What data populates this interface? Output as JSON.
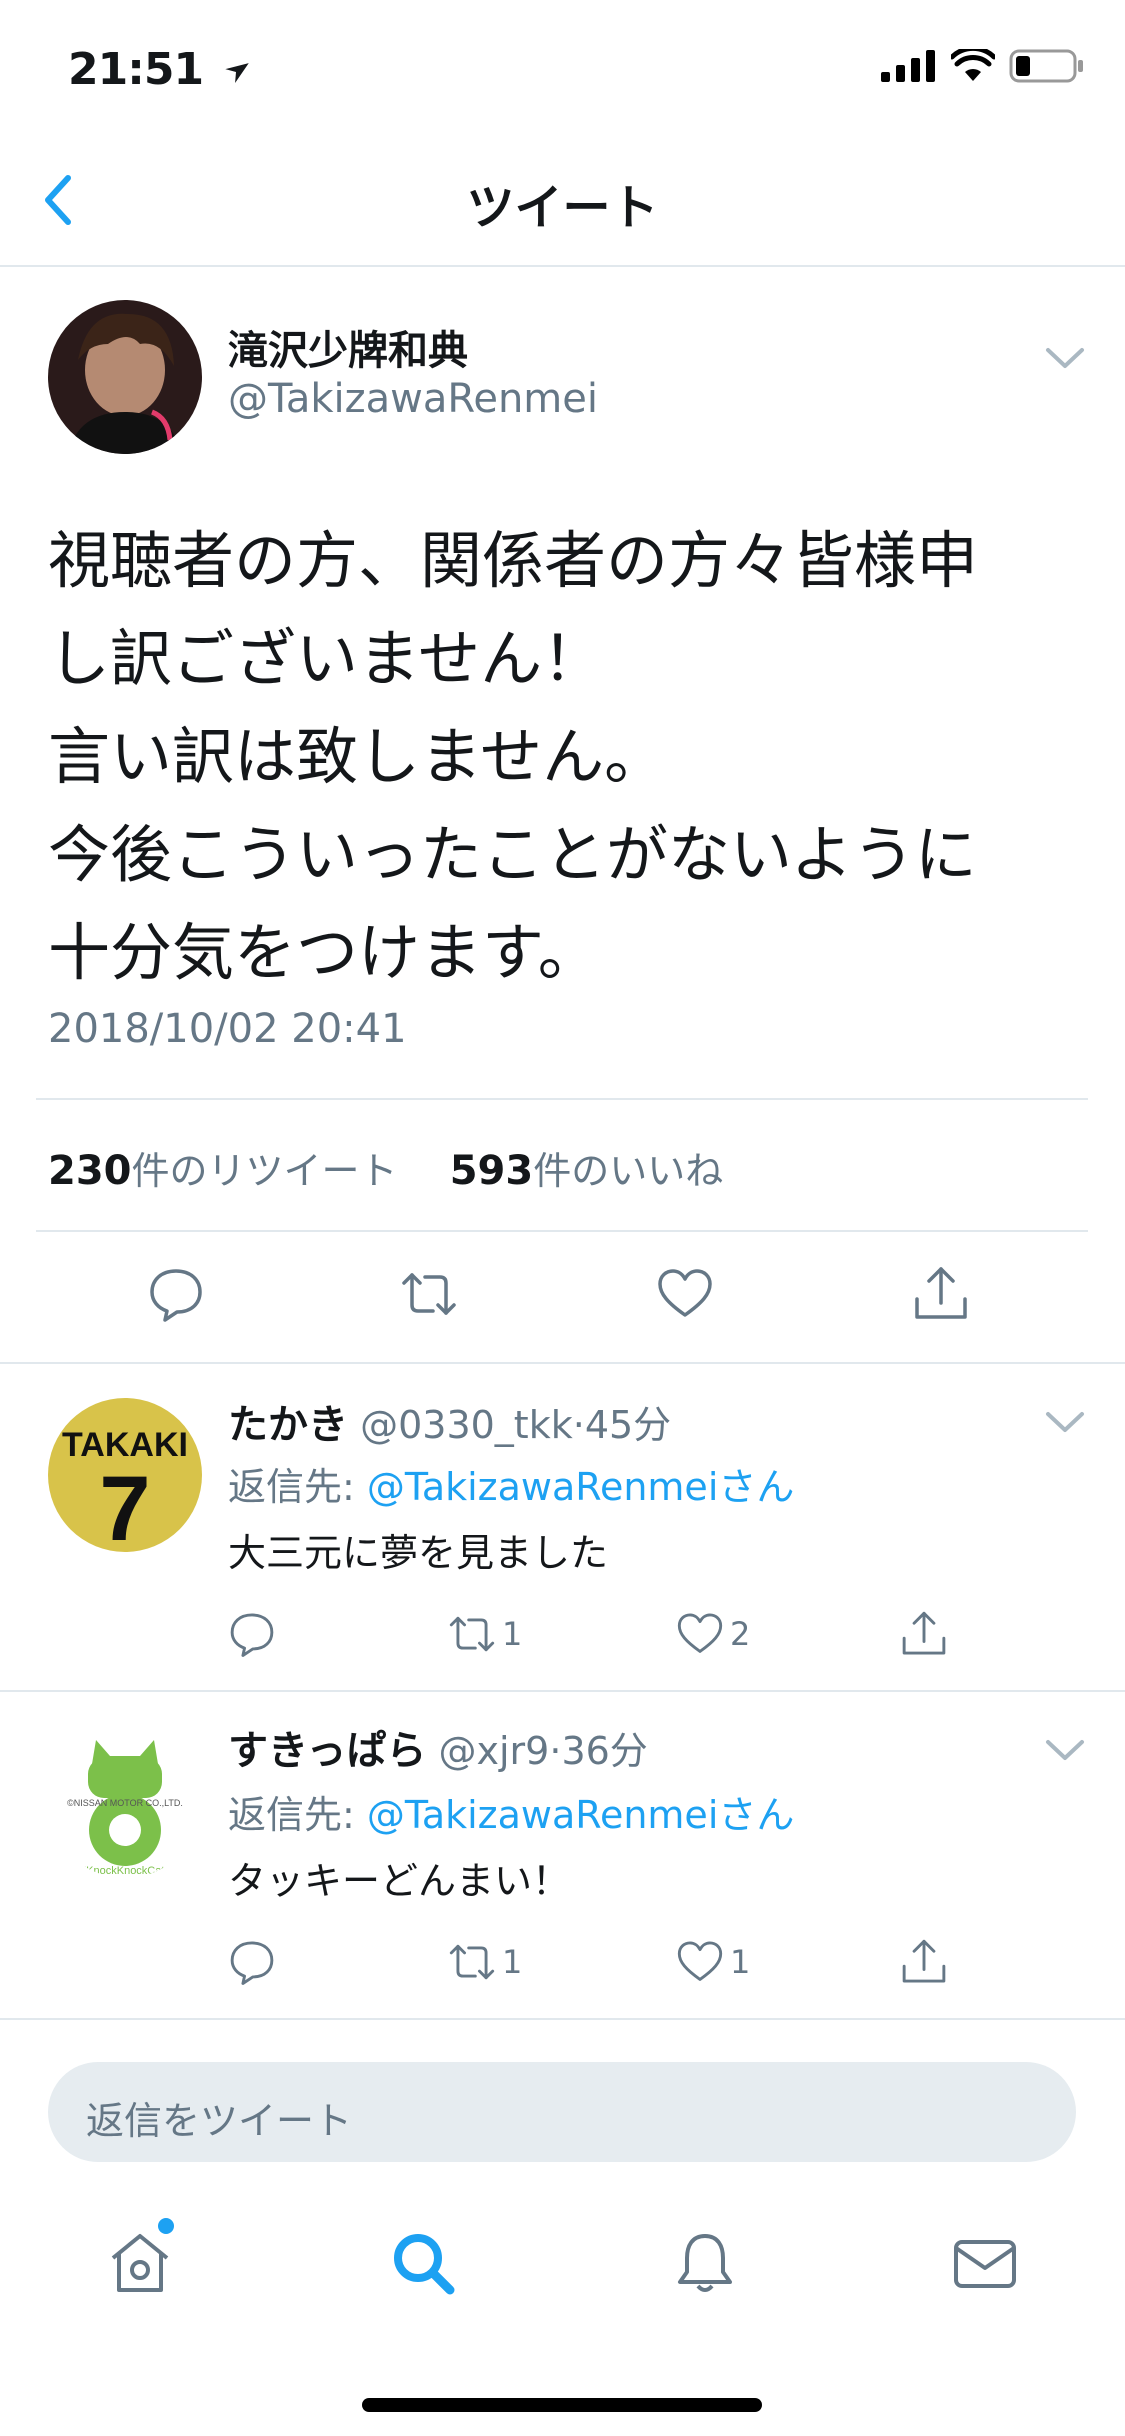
{
  "status_bar": {
    "time": "21:51"
  },
  "nav": {
    "title": "ツイート"
  },
  "tweet": {
    "author_name": "滝沢少牌和典",
    "author_handle": "@TakizawaRenmei",
    "lines": [
      "視聴者の方、関係者の方々皆様申",
      "し訳ございません！",
      "言い訳は致しません。",
      "今後こういったことがないように",
      "十分気をつけます。"
    ],
    "timestamp": "2018/10/02 20:41",
    "retweets_count": "230",
    "retweets_label": "件のリツイート",
    "likes_count": "593",
    "likes_label": "件のいいね"
  },
  "replies": [
    {
      "name": "たかき",
      "handle": "@0330_tkk",
      "time": "45分",
      "reply_prefix": "返信先: ",
      "reply_mention": "@TakizawaRenmei",
      "reply_suffix": "さん",
      "text": "大三元に夢を見ました",
      "retweets": "1",
      "likes": "2",
      "avatar_text": "TAKAKI",
      "avatar_number": "7"
    },
    {
      "name": "すきっぱら",
      "handle": "@xjr9",
      "time": "36分",
      "reply_prefix": "返信先: ",
      "reply_mention": "@TakizawaRenmei",
      "reply_suffix": "さん",
      "text": "タッキーどんまい！",
      "retweets": "1",
      "likes": "1",
      "avatar_text": "©NISSAN MOTOR CO.,LTD.",
      "avatar_text2": "#KnockKnockCats"
    }
  ],
  "composer": {
    "placeholder": "返信をツイート"
  },
  "colors": {
    "accent": "#1da1f2",
    "secondary_text": "#657786",
    "divider": "#e1e8ed",
    "composer_bg": "#e6ecf0"
  },
  "icons": [
    "back-chevron-icon",
    "caret-down-icon",
    "reply-icon",
    "retweet-icon",
    "like-icon",
    "share-icon",
    "home-icon",
    "search-icon",
    "notifications-icon",
    "messages-icon"
  ]
}
